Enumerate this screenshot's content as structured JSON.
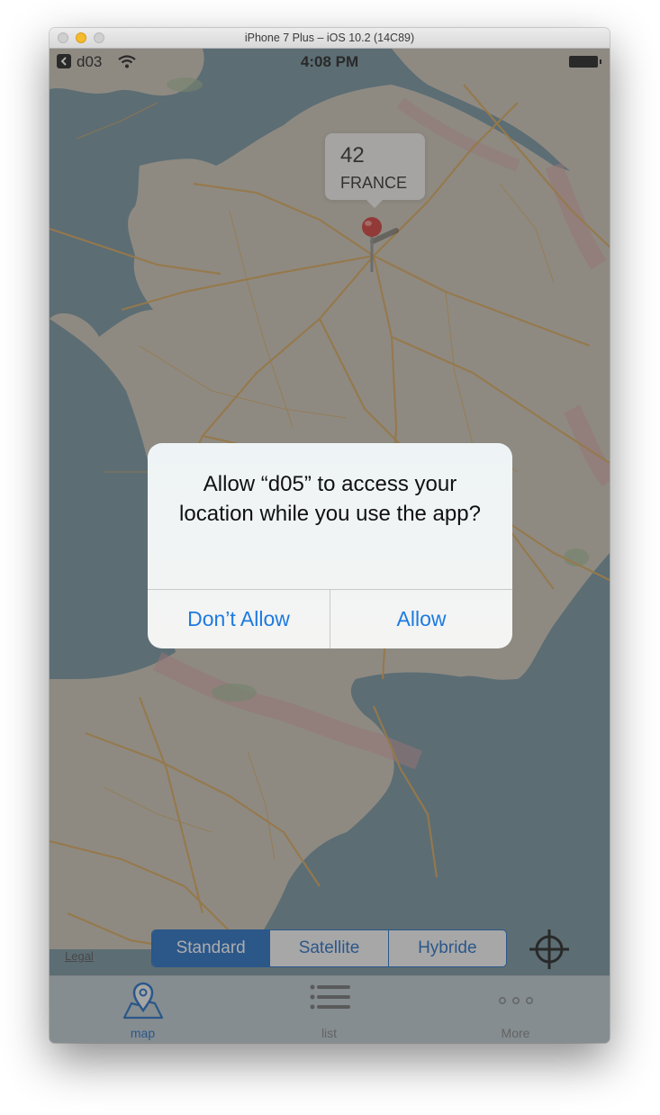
{
  "window": {
    "title": "iPhone 7 Plus – iOS 10.2 (14C89)"
  },
  "status_bar": {
    "back_app": "d03",
    "time": "4:08 PM"
  },
  "map": {
    "callout": {
      "title": "42",
      "subtitle": "FRANCE"
    },
    "legal_label": "Legal"
  },
  "alert": {
    "message": "Allow “d05” to access your location while you use the app?",
    "buttons": [
      "Don’t Allow",
      "Allow"
    ]
  },
  "map_type_selector": {
    "options": [
      "Standard",
      "Satellite",
      "Hybride"
    ],
    "selected": "Standard"
  },
  "tab_bar": {
    "items": [
      {
        "label": "map",
        "icon": "map-pin-icon",
        "selected": true
      },
      {
        "label": "list",
        "icon": "list-icon",
        "selected": false
      },
      {
        "label": "More",
        "icon": "more-dots-icon",
        "selected": false
      }
    ]
  },
  "colors": {
    "accent": "#1565c0",
    "alert_button": "#1d7ae0",
    "sea": "#6e8d99",
    "land": "#c9c2b3",
    "roads": "#d7a24e"
  }
}
